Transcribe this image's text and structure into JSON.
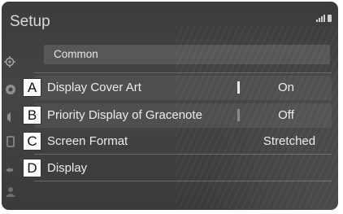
{
  "header": {
    "title": "Setup"
  },
  "section": {
    "label": "Common"
  },
  "rows": [
    {
      "badge": "A",
      "label": "Display Cover Art",
      "value": "On"
    },
    {
      "badge": "B",
      "label": "Priority Display of Gracenote",
      "value": "Off"
    },
    {
      "badge": "C",
      "label": "Screen Format",
      "value": "Stretched"
    },
    {
      "badge": "D",
      "label": "Display",
      "value": ""
    }
  ],
  "icons": {
    "status": [
      "signal-strength-icon",
      "battery-icon"
    ],
    "sidebar": [
      "settings-gear-icon",
      "radio-icon",
      "speaker-icon",
      "phone-icon",
      "usb-icon",
      "person-icon"
    ]
  }
}
